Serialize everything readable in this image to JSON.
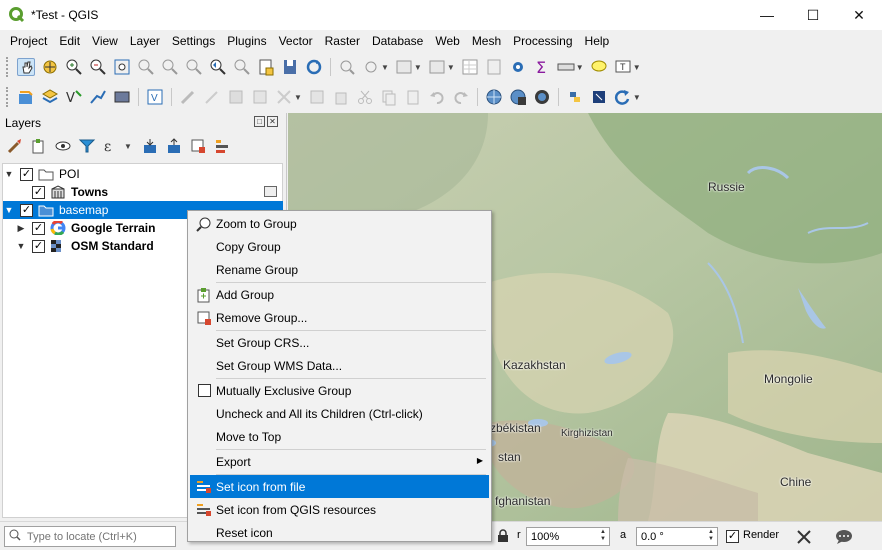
{
  "window": {
    "title": "*Test - QGIS",
    "controls": [
      "minimize",
      "maximize",
      "close"
    ]
  },
  "menubar": {
    "items": [
      "Project",
      "Edit",
      "View",
      "Layer",
      "Settings",
      "Plugins",
      "Vector",
      "Raster",
      "Database",
      "Web",
      "Mesh",
      "Processing",
      "Help"
    ]
  },
  "layers_panel": {
    "title": "Layers",
    "tree": [
      {
        "label": "POI",
        "checked": true,
        "expanded": true,
        "type": "group",
        "bold": false
      },
      {
        "label": "Towns",
        "checked": true,
        "type": "layer",
        "bold": true
      },
      {
        "label": "basemap",
        "checked": true,
        "expanded": true,
        "type": "group",
        "selected": true
      },
      {
        "label": "Google Terrain",
        "checked": true,
        "expanded": false,
        "type": "layer",
        "bold": true
      },
      {
        "label": "OSM Standard",
        "checked": true,
        "expanded": true,
        "type": "layer",
        "bold": true
      }
    ]
  },
  "context_menu": {
    "items": [
      {
        "label": "Zoom to Group",
        "icon": "zoom-icon"
      },
      {
        "label": "Copy Group"
      },
      {
        "label": "Rename Group"
      },
      {
        "label": "Add Group",
        "icon": "add-group-icon"
      },
      {
        "label": "Remove Group...",
        "icon": "remove-group-icon"
      },
      {
        "label": "Set Group CRS..."
      },
      {
        "label": "Set Group WMS Data..."
      },
      {
        "label": "Mutually Exclusive Group",
        "checkable": true,
        "checked": false
      },
      {
        "label": "Uncheck and All its Children (Ctrl-click)"
      },
      {
        "label": "Move to Top"
      },
      {
        "label": "Export",
        "submenu": true
      },
      {
        "label": "Set icon from file",
        "highlighted": true,
        "icon": "icon-file-icon"
      },
      {
        "label": "Set icon from QGIS resources",
        "icon": "icon-resources-icon"
      },
      {
        "label": "Reset icon"
      }
    ]
  },
  "map": {
    "labels": [
      {
        "text": "Russie"
      },
      {
        "text": "Kazakhstan"
      },
      {
        "text": "Mongolie"
      },
      {
        "text": "zbékistan"
      },
      {
        "text": "Kirghizistan"
      },
      {
        "text": "stan"
      },
      {
        "text": "Chine"
      },
      {
        "text": "fghanistan"
      }
    ]
  },
  "statusbar": {
    "locate_placeholder": "Type to locate (Ctrl+K)",
    "magnifier_prefix": "r",
    "magnifier": "100%",
    "rotation_prefix": "a",
    "rotation": "0.0 °",
    "render_label": "Render",
    "render_checked": true
  },
  "colors": {
    "selection": "#0078d7",
    "map_base": "#b9c7a6",
    "water": "#a9c6e6"
  }
}
